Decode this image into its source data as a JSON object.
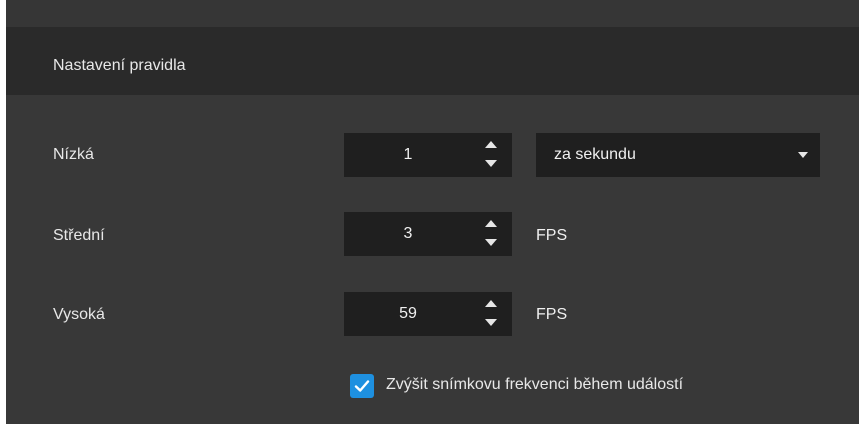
{
  "section": {
    "title": "Nastavení pravidla"
  },
  "rows": [
    {
      "label": "Nízká",
      "value": "1",
      "unit_dropdown": "za sekundu"
    },
    {
      "label": "Střední",
      "value": "3",
      "unit": "FPS"
    },
    {
      "label": "Vysoká",
      "value": "59",
      "unit": "FPS"
    }
  ],
  "checkbox": {
    "label": "Zvýšit snímkovu frekvenci během událostí",
    "checked": true
  },
  "colors": {
    "accent": "#1e90e0",
    "panel": "#383838",
    "header": "#2a2a2a",
    "field": "#1f1f1f"
  },
  "icons": {
    "spin_up": "chevron-up-icon",
    "spin_down": "chevron-down-icon",
    "dropdown": "caret-down-icon",
    "check": "check-icon"
  }
}
